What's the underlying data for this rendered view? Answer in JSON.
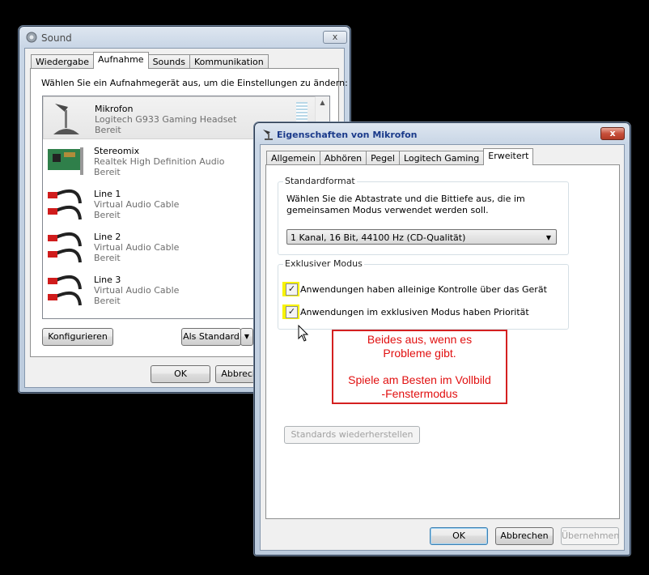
{
  "sound": {
    "title": "Sound",
    "close": "x",
    "tabs": [
      "Wiedergabe",
      "Aufnahme",
      "Sounds",
      "Kommunikation"
    ],
    "active_tab": "Aufnahme",
    "instruction": "Wählen Sie ein Aufnahmegerät aus, um die Einstellungen zu ändern:",
    "devices": [
      {
        "name": "Mikrofon",
        "desc": "Logitech G933 Gaming Headset",
        "status": "Bereit",
        "icon": "microphone-icon"
      },
      {
        "name": "Stereomix",
        "desc": "Realtek High Definition Audio",
        "status": "Bereit",
        "icon": "sound-card-icon"
      },
      {
        "name": "Line 1",
        "desc": "Virtual Audio Cable",
        "status": "Bereit",
        "icon": "rca-cable-icon"
      },
      {
        "name": "Line 2",
        "desc": "Virtual Audio Cable",
        "status": "Bereit",
        "icon": "rca-cable-icon"
      },
      {
        "name": "Line 3",
        "desc": "Virtual Audio Cable",
        "status": "Bereit",
        "icon": "rca-cable-icon"
      }
    ],
    "configure_label": "Konfigurieren",
    "default_label": "Als Standard",
    "ok_label": "OK",
    "cancel_label": "Abbrechen"
  },
  "props": {
    "title": "Eigenschaften von Mikrofon",
    "close": "x",
    "tabs": [
      "Allgemein",
      "Abhören",
      "Pegel",
      "Logitech Gaming",
      "Erweitert"
    ],
    "active_tab": "Erweitert",
    "standard_group": "Standardformat",
    "standard_desc_1": "Wählen Sie die Abtastrate und die Bittiefe aus, die im",
    "standard_desc_2": "gemeinsamen Modus verwendet werden soll.",
    "format_value": "1 Kanal, 16 Bit, 44100 Hz (CD-Qualität)",
    "exclusive_group": "Exklusiver Modus",
    "exclusive_option_1": "Anwendungen haben alleinige Kontrolle über das Gerät",
    "exclusive_option_1_checked": true,
    "exclusive_option_2": "Anwendungen im exklusiven Modus haben Priorität",
    "exclusive_option_2_checked": true,
    "checkmark": "✓",
    "restore_label": "Standards wiederherstellen",
    "ok_label": "OK",
    "cancel_label": "Abbrechen",
    "apply_label": "Übernehmen"
  },
  "annotation": {
    "line1": "Beides aus, wenn es",
    "line2": "Probleme gibt.",
    "line3": "Spiele am Besten im Vollbild",
    "line4": "-Fenstermodus",
    "color": "#e11010"
  },
  "colors": {
    "title_text_active": "#1a3a8a",
    "highlight": "#f7f300"
  }
}
